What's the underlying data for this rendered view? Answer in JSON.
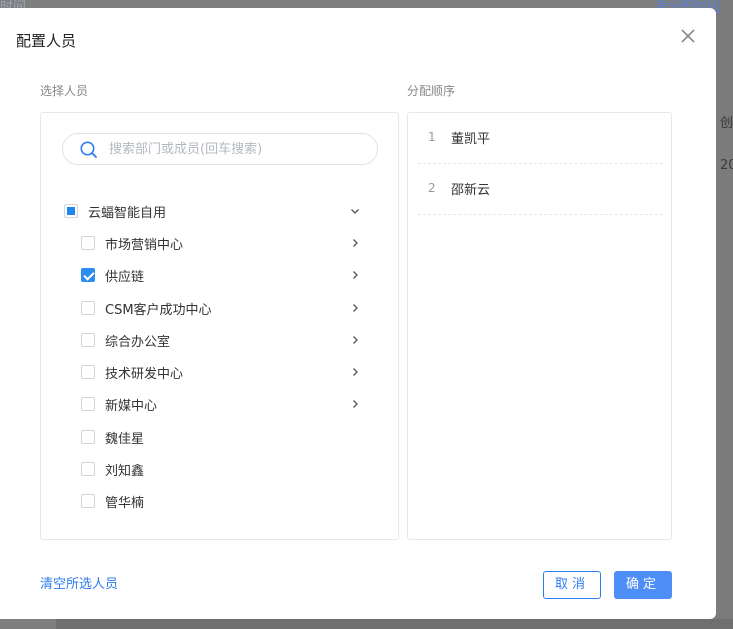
{
  "background": {
    "left_text": "时间",
    "right_link": "录分配时间",
    "right_texts": [
      "创",
      "20"
    ]
  },
  "dialog": {
    "title": "配置人员",
    "close_icon": "close-icon"
  },
  "left_section": {
    "label": "选择人员",
    "search": {
      "placeholder": "搜索部门或成员(回车搜索)",
      "value": ""
    },
    "root": {
      "label": "云蝠智能自用",
      "state": "indeterminate",
      "expanded": true
    },
    "children": [
      {
        "label": "市场营销中心",
        "checked": false,
        "has_children": true
      },
      {
        "label": "供应链",
        "checked": true,
        "has_children": true
      },
      {
        "label": "CSM客户成功中心",
        "checked": false,
        "has_children": true
      },
      {
        "label": "综合办公室",
        "checked": false,
        "has_children": true
      },
      {
        "label": "技术研发中心",
        "checked": false,
        "has_children": true
      },
      {
        "label": "新媒中心",
        "checked": false,
        "has_children": true
      },
      {
        "label": "魏佳星",
        "checked": false,
        "has_children": false
      },
      {
        "label": "刘知鑫",
        "checked": false,
        "has_children": false
      },
      {
        "label": "管华楠",
        "checked": false,
        "has_children": false
      }
    ]
  },
  "right_section": {
    "label": "分配顺序",
    "items": [
      {
        "index": "1",
        "name": "董凯平"
      },
      {
        "index": "2",
        "name": "邵新云"
      }
    ]
  },
  "footer": {
    "clear_label": "清空所选人员",
    "cancel_label": "取消",
    "ok_label": "确定"
  },
  "colors": {
    "accent": "#2d8cf0",
    "primary_button": "#4e8ef7"
  }
}
